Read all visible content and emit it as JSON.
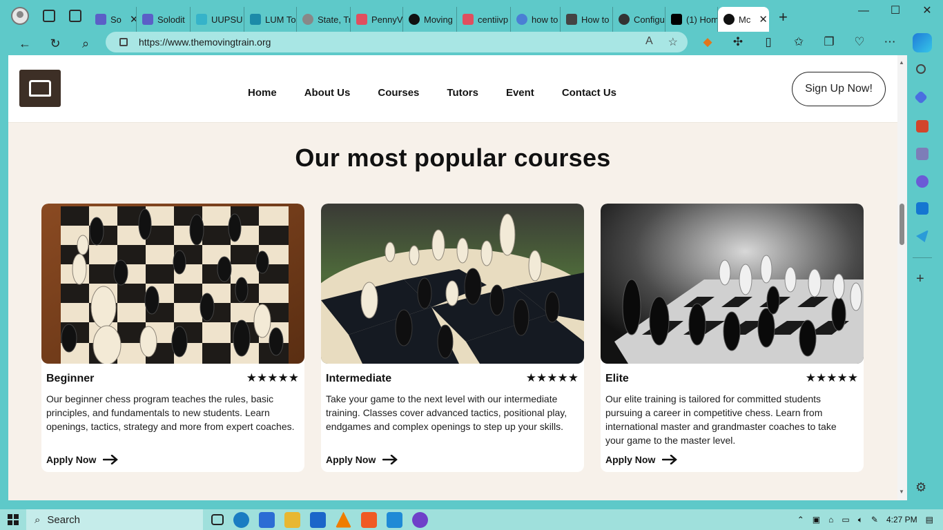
{
  "browser": {
    "tabs": [
      {
        "label": "So",
        "color": "#5b5fc7"
      },
      {
        "label": "Solodit",
        "color": "#5b5fc7"
      },
      {
        "label": "UUPSU",
        "color": "#36b3c9"
      },
      {
        "label": "LUM To",
        "color": "#1c8aa8"
      },
      {
        "label": "State, Tr",
        "color": "#888888"
      },
      {
        "label": "PennyV",
        "color": "#e04f5f"
      },
      {
        "label": "Moving",
        "color": "#111111"
      },
      {
        "label": "centiivp",
        "color": "#e04f5f"
      },
      {
        "label": "how to",
        "color": "#4a7fd4"
      },
      {
        "label": "How to",
        "color": "#444444"
      },
      {
        "label": "Configu",
        "color": "#333333"
      },
      {
        "label": "(1) Hom",
        "color": "#000000"
      }
    ],
    "active_tab": {
      "label": "Mc",
      "color": "#111111"
    },
    "url": "https://www.themovingtrain.org",
    "window_controls": {
      "minimize": "—",
      "maximize": "☐",
      "close": "✕"
    }
  },
  "site": {
    "nav": {
      "items": [
        "Home",
        "About Us",
        "Courses",
        "Tutors",
        "Event",
        "Contact Us"
      ],
      "cta": "Sign Up Now!"
    },
    "section_title": "Our most popular courses",
    "courses": [
      {
        "title": "Beginner",
        "rating": 5,
        "stars": "★★★★★",
        "description": "Our beginner chess program teaches the rules, basic principles, and fundamentals to new students. Learn openings, tactics, strategy and more from expert coaches.",
        "cta": "Apply Now"
      },
      {
        "title": "Intermediate",
        "rating": 5,
        "stars": "★★★★★",
        "description": "Take your game to the next level with our intermediate training. Classes cover advanced tactics, positional play, endgames and complex openings to step up your skills.",
        "cta": "Apply Now"
      },
      {
        "title": "Elite",
        "rating": 5,
        "stars": "★★★★★",
        "description": "Our elite training is tailored for committed students pursuing a career in competitive chess. Learn from international master and grandmaster coaches to take your game to the master level.",
        "cta": "Apply Now"
      }
    ]
  },
  "taskbar": {
    "search_placeholder": "Search",
    "clock": "4:27 PM"
  }
}
